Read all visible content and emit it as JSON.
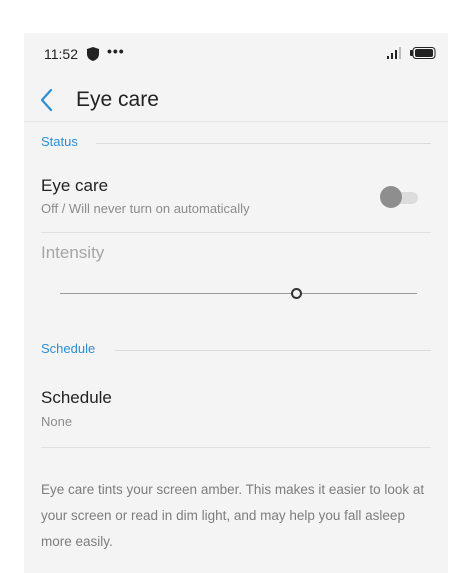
{
  "status_bar": {
    "time": "11:52",
    "icons": [
      "shield-icon",
      "more-dots-icon",
      "signal-icon",
      "battery-icon"
    ]
  },
  "toolbar": {
    "back_icon": "chevron-left-icon",
    "title": "Eye care"
  },
  "sections": {
    "status_label": "Status",
    "schedule_label": "Schedule"
  },
  "eye_care": {
    "title": "Eye care",
    "subtitle": "Off / Will never turn on automatically",
    "toggle_on": false
  },
  "intensity": {
    "label": "Intensity",
    "enabled": false,
    "value_fraction": 0.66
  },
  "schedule": {
    "title": "Schedule",
    "value": "None"
  },
  "footer_note": "Eye care tints your screen amber. This makes it easier to look at your screen or read in dim light, and may help you fall asleep more easily.",
  "colors": {
    "accent": "#2b8ed4",
    "background": "#f4f4f4",
    "toggle_off_thumb": "#8e8e8e"
  }
}
